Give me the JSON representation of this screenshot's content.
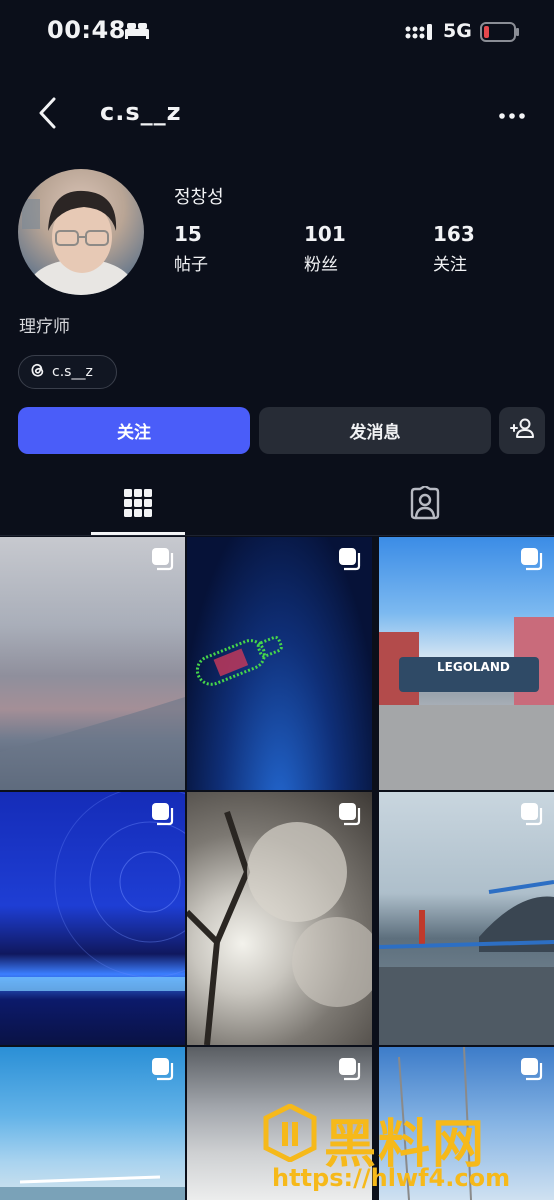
{
  "status_bar": {
    "time": "00:48",
    "network": "5G",
    "icons": [
      "bed-icon",
      "signal-icon",
      "battery-icon"
    ],
    "battery_color": "#e5484d"
  },
  "nav": {
    "username": "c.s__z",
    "icons": [
      "back-arrow-icon",
      "more-options-icon"
    ]
  },
  "profile": {
    "display_name": "정창성",
    "stats": [
      {
        "value": "15",
        "label": "帖子"
      },
      {
        "value": "101",
        "label": "粉丝"
      },
      {
        "value": "163",
        "label": "关注"
      }
    ],
    "bio": "理疗师",
    "threads_handle": "c.s__z"
  },
  "actions": {
    "follow_label": "关注",
    "message_label": "发消息",
    "accent_color": "#4a5df9"
  },
  "tabs": [
    {
      "name": "grid",
      "icon": "grid-icon",
      "active": true
    },
    {
      "name": "tagged",
      "icon": "tagged-person-icon",
      "active": false
    }
  ],
  "posts": [
    {
      "kind": "carousel"
    },
    {
      "kind": "carousel"
    },
    {
      "kind": "carousel",
      "sign_text": "LEGOLAND"
    },
    {
      "kind": "carousel"
    },
    {
      "kind": "carousel"
    },
    {
      "kind": "carousel"
    },
    {
      "kind": "carousel"
    },
    {
      "kind": "carousel"
    },
    {
      "kind": "carousel"
    }
  ],
  "watermark": {
    "text": "黑料网",
    "url": "https://hlwf4.com"
  }
}
